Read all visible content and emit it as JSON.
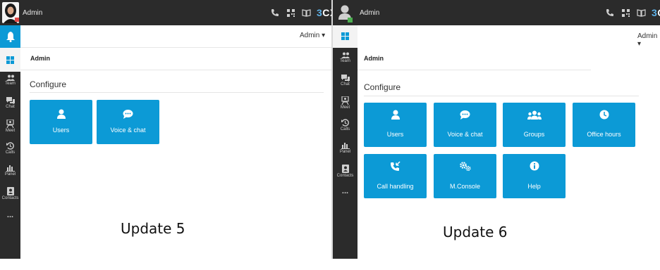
{
  "colors": {
    "dark": "#2b2b2b",
    "accent": "#0c9ad6",
    "logo_blue": "#5fb2e8"
  },
  "left": {
    "topbar": {
      "title": "Admin",
      "logo_num": "3",
      "logo_txt": "CX"
    },
    "sidebar": [
      {
        "label": "",
        "icon": "bell-icon"
      },
      {
        "label": "",
        "icon": "windows-icon"
      },
      {
        "label": "Team",
        "icon": "team-icon"
      },
      {
        "label": "Chat",
        "icon": "chat-icon"
      },
      {
        "label": "Meet",
        "icon": "meet-icon"
      },
      {
        "label": "Calls",
        "icon": "calls-icon"
      },
      {
        "label": "Panel",
        "icon": "panel-icon"
      },
      {
        "label": "Contacts",
        "icon": "contacts-icon"
      },
      {
        "label": "...",
        "icon": "more-icon"
      }
    ],
    "admin_menu": "Admin ▾",
    "breadcrumb": "Admin",
    "configure": "Configure",
    "tiles": [
      {
        "label": "Users",
        "icon": "user-icon"
      },
      {
        "label": "Voice & chat",
        "icon": "chat-bubble-icon"
      }
    ],
    "caption": "Update 5"
  },
  "right": {
    "topbar": {
      "title": "Admin",
      "logo_num": "3",
      "logo_txt": "C"
    },
    "sidebar": [
      {
        "label": "",
        "icon": "windows-icon"
      },
      {
        "label": "Team",
        "icon": "team-icon"
      },
      {
        "label": "Chat",
        "icon": "chat-icon"
      },
      {
        "label": "Meet",
        "icon": "meet-icon"
      },
      {
        "label": "Calls",
        "icon": "calls-icon"
      },
      {
        "label": "Panel",
        "icon": "panel-icon"
      },
      {
        "label": "Contacts",
        "icon": "contacts-icon"
      },
      {
        "label": "...",
        "icon": "more-icon"
      }
    ],
    "admin_menu": "Admin ▾",
    "breadcrumb": "Admin",
    "configure": "Configure",
    "tiles": [
      {
        "label": "Users",
        "icon": "user-icon"
      },
      {
        "label": "Voice & chat",
        "icon": "chat-bubble-icon"
      },
      {
        "label": "Groups",
        "icon": "groups-icon"
      },
      {
        "label": "Office hours",
        "icon": "clock-icon"
      },
      {
        "label": "Call handling",
        "icon": "call-forward-icon"
      },
      {
        "label": "M.Console",
        "icon": "cogs-icon"
      },
      {
        "label": "Help",
        "icon": "info-icon"
      }
    ],
    "caption": "Update 6"
  }
}
